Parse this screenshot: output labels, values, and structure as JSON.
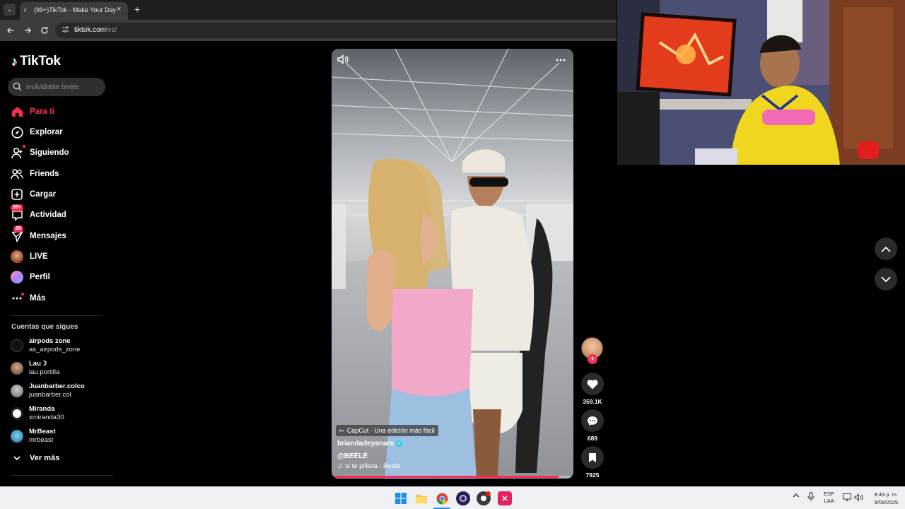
{
  "browser": {
    "tab_title": "(99+)TikTok - Make Your Day",
    "tab_close": "×",
    "new_tab": "+",
    "url_host": "tiktok.com",
    "url_path": "/es/"
  },
  "sidebar": {
    "logo": "TikTok",
    "search_placeholder": "inolvidable beéle",
    "nav": [
      {
        "label": "Para ti",
        "icon": "home-icon",
        "active": true
      },
      {
        "label": "Explorar",
        "icon": "compass-icon"
      },
      {
        "label": "Siguiendo",
        "icon": "following-icon"
      },
      {
        "label": "Friends",
        "icon": "friends-icon"
      },
      {
        "label": "Cargar",
        "icon": "upload-icon"
      },
      {
        "label": "Actividad",
        "icon": "activity-icon",
        "badge": "99+"
      },
      {
        "label": "Mensajes",
        "icon": "messages-icon",
        "badge": "28"
      },
      {
        "label": "LIVE",
        "icon": "live-icon"
      },
      {
        "label": "Perfil",
        "icon": "profile-icon"
      },
      {
        "label": "Más",
        "icon": "more-icon"
      }
    ],
    "following_header": "Cuentas que sigues",
    "accounts": [
      {
        "name": "airpods zone",
        "handle": "as_airpods_zone"
      },
      {
        "name": "Lau☽",
        "handle": "lau.portilla"
      },
      {
        "name": "Juanbarber.colco",
        "handle": "juanbarber.col"
      },
      {
        "name": "Miranda",
        "handle": "xmiranda30"
      },
      {
        "name": "MrBeast",
        "handle": "mrbeast"
      }
    ],
    "see_more": "Ver más"
  },
  "video": {
    "capcut_tag": "CapCut · Una edición más fácil",
    "author": "briandadeyanara",
    "caption": "@BEÉLE",
    "sound": "si te pillara - Beéle",
    "progress": 0.94
  },
  "actions": {
    "likes": "359.1K",
    "comments": "689",
    "saves": "7925"
  },
  "taskbar": {
    "lang_line1": "ESP",
    "lang_line2": "LAA",
    "time": "8:49 p. m.",
    "date": "9/09/2025"
  },
  "colors": {
    "accent": "#fe2c55",
    "background": "#000000"
  }
}
